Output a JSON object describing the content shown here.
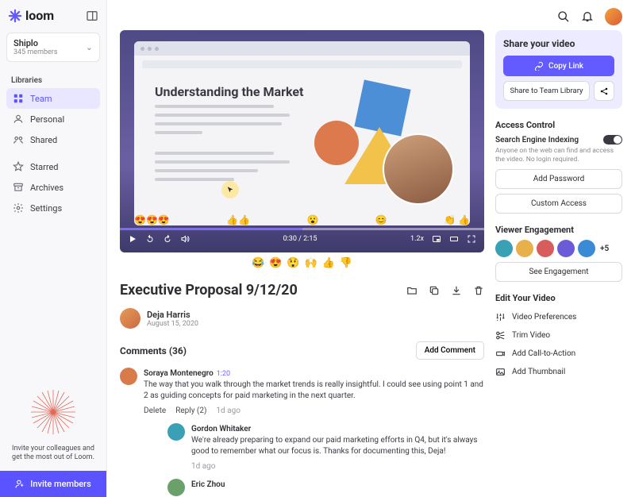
{
  "brand": "loom",
  "workspace": {
    "name": "Shiplo",
    "members": "345 members"
  },
  "sidebar": {
    "libraries_label": "Libraries",
    "items": [
      {
        "label": "Team",
        "icon": "team"
      },
      {
        "label": "Personal",
        "icon": "personal"
      },
      {
        "label": "Shared",
        "icon": "shared"
      }
    ],
    "secondary": [
      {
        "label": "Starred",
        "icon": "star"
      },
      {
        "label": "Archives",
        "icon": "archive"
      },
      {
        "label": "Settings",
        "icon": "gear"
      }
    ],
    "invite_copy": "Invite your colleagues and get the most out of Loom.",
    "invite_btn": "Invite members"
  },
  "player": {
    "doc_title": "Understanding the Market",
    "time": "0:30  /  2:15",
    "speed": "1.2x",
    "emoji_marks": [
      "😍😍😍",
      "👍👍",
      "😮",
      "😊",
      "👏 👍"
    ],
    "reactions": [
      "😂",
      "😍",
      "😲",
      "🙌",
      "👍",
      "👎"
    ]
  },
  "video": {
    "title": "Executive Proposal 9/12/20",
    "author": "Deja Harris",
    "date": "August 15, 2020"
  },
  "comments": {
    "header": "Comments (36)",
    "add_btn": "Add Comment",
    "list": [
      {
        "name": "Soraya Montenegro",
        "ts": "1:20",
        "body": "The way that you walk through the market trends is really insightful. I could see using point 1 and 2 as guiding concepts for paid marketing in the next quarter.",
        "av": "#d97a4a",
        "actions": {
          "delete": "Delete",
          "reply": "Reply (2)",
          "age": "1d ago"
        },
        "replies": [
          {
            "name": "Gordon Whitaker",
            "body": "We're already preparing to expand our paid marketing efforts in Q4, but it's always good to remember what our focus is. Thanks for documenting this, Deja!",
            "age": "1d ago",
            "av": "#3aa0b5"
          },
          {
            "name": "Eric Zhou",
            "body": "",
            "av": "#6aa06a"
          }
        ]
      }
    ]
  },
  "share": {
    "heading": "Share your video",
    "copy": "Copy Link",
    "team": "Share to Team Library"
  },
  "access": {
    "heading": "Access Control",
    "toggle_label": "Search Engine Indexing",
    "sub": "Anyone on the web can find and access the video. No login required.",
    "pw": "Add Password",
    "custom": "Custom Access"
  },
  "engagement": {
    "heading": "Viewer Engagement",
    "plus": "+5",
    "btn": "See Engagement",
    "viewers": [
      "#3aa0b5",
      "#e8b04a",
      "#d95c5c",
      "#6b5bd6",
      "#3a8ad6"
    ]
  },
  "edit": {
    "heading": "Edit Your Video",
    "items": [
      {
        "label": "Video Preferences",
        "icon": "sliders"
      },
      {
        "label": "Trim Video",
        "icon": "scissors"
      },
      {
        "label": "Add Call-to-Action",
        "icon": "cta"
      },
      {
        "label": "Add Thumbnail",
        "icon": "image"
      }
    ]
  }
}
